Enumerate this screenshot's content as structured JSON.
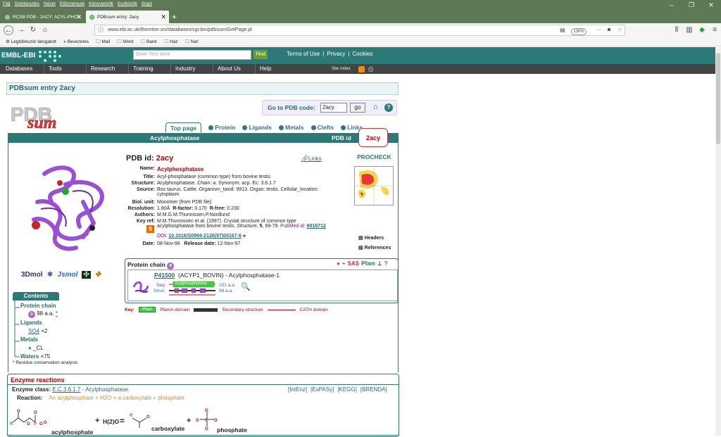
{
  "browser": {
    "menu": [
      "Fájl",
      "Szerkesztés",
      "Nézet",
      "Előzmények",
      "Könyvjelzők",
      "Eszközök",
      "Súgó"
    ],
    "tabs": [
      {
        "title": "RCSB PDB - 2ACY: ACYL-PHOS"
      },
      {
        "title": "PDBsum entry: 2acy"
      }
    ],
    "url": "www.ebi.ac.uk/thornton-srv/databases/cgi-bin/pdbsum/GetPage.pl",
    "zoom": "130%",
    "bookmarks": [
      "Legtöbbször látogatott",
      "Bevezetés",
      "Mail",
      "Work",
      "Bank",
      "Haz",
      "Net"
    ]
  },
  "ebi": {
    "logo": "EMBL-EBI",
    "search_placeholder": "Enter Text Here",
    "find": "Find",
    "links": [
      "Terms of Use",
      "|",
      "Privacy",
      "|",
      "Cookies"
    ],
    "nav": [
      "Databases",
      "Tools",
      "Research",
      "Training",
      "Industry",
      "About Us",
      "Help"
    ],
    "site_index": "Site Index"
  },
  "page": {
    "title": "PDBsum entry 2acy",
    "go_label": "Go to PDB code:",
    "go_value": "2acy",
    "go_button": "go",
    "tabs": [
      "Top page",
      "Protein",
      "Ligands",
      "Metals",
      "Clefts",
      "Links"
    ],
    "id_box": "2acy",
    "bar_left": "Acylphosphatase",
    "bar_right": "PDB id",
    "tools": [
      "3Dmol",
      "Jmol",
      "Jsmol",
      "Jmol",
      "Jmol"
    ],
    "pdb_id_label": "PDB id:",
    "pdb_id": "2acy",
    "links": "Links",
    "procheck": "PROCHECK",
    "headers": "Headers",
    "references": "References",
    "fields": {
      "name_k": "Name:",
      "name": "Acylphosphatase",
      "title_k": "Title:",
      "title": "Acyl-phosphatase (common type) from bovine testis",
      "structure_k": "Structure:",
      "structure": "Acylphosphatase. Chain: a. Synonym: acp. Ec: 3.6.1.7",
      "source_k": "Source:",
      "source": "Bos taurus. Cattle. Organism_taxid: 9913. Organ: testis. Cellular_location: cytoplasm",
      "biol_k": "Biol. unit:",
      "biol": "Monomer (from PDB file)",
      "res_k": "Resolution:",
      "res": "1.80Å",
      "rfactor_k": "R-factor:",
      "rfactor": "0.170",
      "rfree_k": "R-free:",
      "rfree": "0.230",
      "authors_k": "Authors:",
      "authors": "M.M.G.M.Thunnissen,P.Nordlund",
      "keyref_k": "Key ref:",
      "keyref_a": "M.M.Thunnissen et al. (1997). Crystal structure of common type acylphosphatase from bovine testis.",
      "keyref_journal": "Structure,",
      "keyref_vol": "5",
      "keyref_pages": ", 69-79.",
      "pubmed": "PubMed id:",
      "pubmed_id": "9016712",
      "doi_k": "DOI:",
      "doi": "10.1016/S0969-2126(97)00167-6",
      "date_k": "Date:",
      "date": "08-Nov-96",
      "release_k": "Release date:",
      "release": "12-Nov-97"
    },
    "chain": {
      "label": "Protein chain",
      "accession": "P41500",
      "entry": "(ACYP1_BOVIN)  -  Acylphosphatase-1",
      "seq": "Seq:",
      "struc": "Struc:",
      "domain": "Acylphosphatase",
      "seq_len": "101 a.a.",
      "struc_len": "98 a.a."
    },
    "key": {
      "label": "Key:",
      "pfam": "PfamA domain",
      "pfam_tag": "Pfam",
      "ss": "Secondary structure",
      "cath": "CATH domain"
    },
    "contents": {
      "header": "Contents",
      "protein_chain": "Protein chain",
      "chain_item": "98 a.a.",
      "chain_star": "*",
      "ligands": "Ligands",
      "so4": "SO4",
      "so4_count": "×2",
      "metals": "Metals",
      "cl": "_CL",
      "waters": "Waters",
      "waters_count": "×75",
      "note": "* Residue conservation analysis"
    },
    "enzyme": {
      "title": "Enzyme reactions",
      "class_label": "Enzyme class:",
      "ec": "E.C.3.6.1.7",
      "ec_name": "- Acylphosphatase.",
      "links": [
        "[IntEnz]",
        "[ExPASy]",
        "[KEGG]",
        "[BRENDA]"
      ],
      "reaction_label": "Reaction:",
      "reaction": "An acylphosphate + H2O = a carboxylate + phosphate",
      "mol1": "acylphosphate",
      "plus1": "+",
      "water": "H(2)O",
      "equals": "=",
      "mol2": "carboxylate",
      "plus2": "+",
      "mol3": "phosphate"
    }
  }
}
